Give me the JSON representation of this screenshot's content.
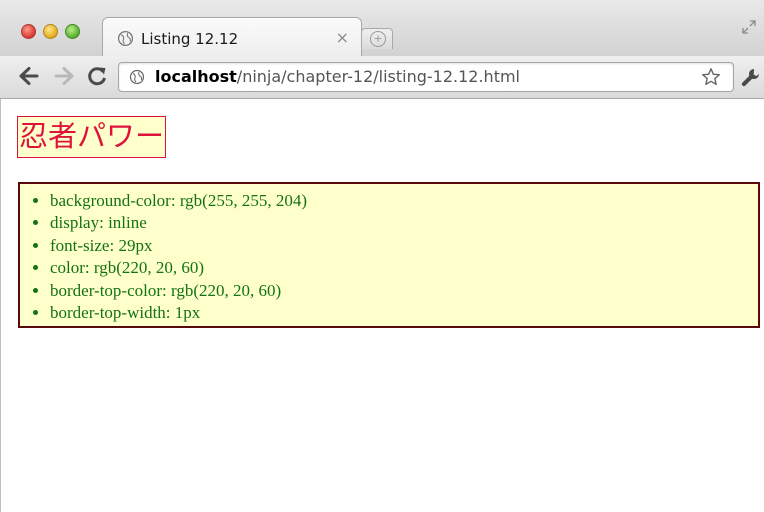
{
  "window": {
    "tab": {
      "title": "Listing 12.12",
      "close_glyph": "×",
      "favicon": "globe-icon"
    },
    "newtab_glyph": "+"
  },
  "toolbar": {
    "url_host": "localhost",
    "url_path": "/ninja/chapter-12/listing-12.12.html",
    "icons": [
      "back-arrow-icon",
      "forward-arrow-icon",
      "reload-icon",
      "globe-icon",
      "star-icon",
      "wrench-icon"
    ]
  },
  "page": {
    "heading": "忍者パワー",
    "computed_styles": [
      "background-color: rgb(255, 255, 204)",
      "display: inline",
      "font-size: 29px",
      "color: rgb(220, 20, 60)",
      "border-top-color: rgb(220, 20, 60)",
      "border-top-width: 1px"
    ]
  },
  "colors": {
    "heading_text": "#dc143c",
    "heading_bg": "#ffffcc",
    "list_text": "#137313",
    "list_border": "#5a0a0a"
  }
}
